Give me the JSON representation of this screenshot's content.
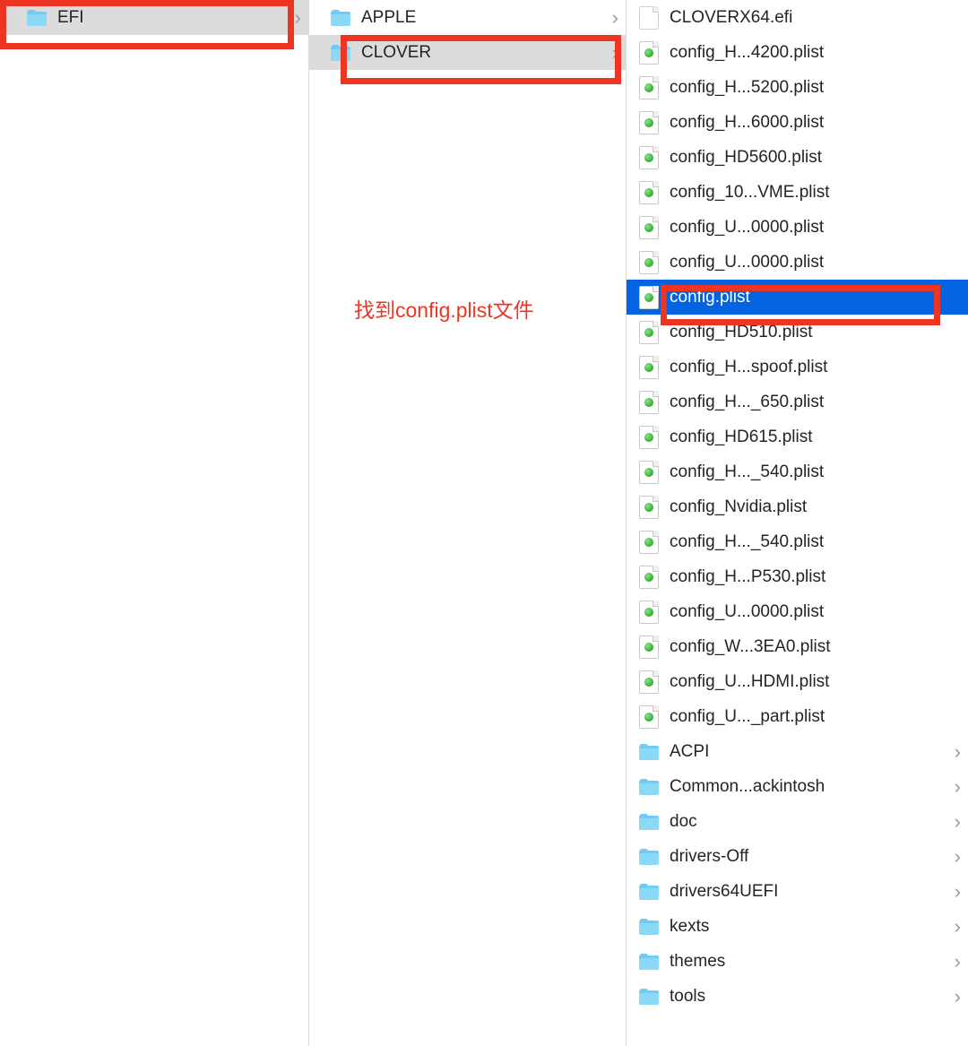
{
  "annotation_text": "找到config.plist文件",
  "column1": {
    "items": [
      {
        "type": "folder",
        "name": "EFI",
        "selected": true
      }
    ]
  },
  "column2": {
    "items": [
      {
        "type": "folder",
        "name": "APPLE",
        "selected": false
      },
      {
        "type": "folder",
        "name": "CLOVER",
        "selected": true
      }
    ]
  },
  "column3": {
    "items": [
      {
        "type": "efi",
        "name": "CLOVERX64.efi",
        "selected": false
      },
      {
        "type": "plist",
        "name": "config_H...4200.plist",
        "selected": false
      },
      {
        "type": "plist",
        "name": "config_H...5200.plist",
        "selected": false
      },
      {
        "type": "plist",
        "name": "config_H...6000.plist",
        "selected": false
      },
      {
        "type": "plist",
        "name": "config_HD5600.plist",
        "selected": false
      },
      {
        "type": "plist",
        "name": "config_10...VME.plist",
        "selected": false
      },
      {
        "type": "plist",
        "name": "config_U...0000.plist",
        "selected": false
      },
      {
        "type": "plist",
        "name": "config_U...0000.plist",
        "selected": false
      },
      {
        "type": "plist",
        "name": "config.plist",
        "selected": true
      },
      {
        "type": "plist",
        "name": "config_HD510.plist",
        "selected": false
      },
      {
        "type": "plist",
        "name": "config_H...spoof.plist",
        "selected": false
      },
      {
        "type": "plist",
        "name": "config_H..._650.plist",
        "selected": false
      },
      {
        "type": "plist",
        "name": "config_HD615.plist",
        "selected": false
      },
      {
        "type": "plist",
        "name": "config_H..._540.plist",
        "selected": false
      },
      {
        "type": "plist",
        "name": "config_Nvidia.plist",
        "selected": false
      },
      {
        "type": "plist",
        "name": "config_H..._540.plist",
        "selected": false
      },
      {
        "type": "plist",
        "name": "config_H...P530.plist",
        "selected": false
      },
      {
        "type": "plist",
        "name": "config_U...0000.plist",
        "selected": false
      },
      {
        "type": "plist",
        "name": "config_W...3EA0.plist",
        "selected": false
      },
      {
        "type": "plist",
        "name": "config_U...HDMI.plist",
        "selected": false
      },
      {
        "type": "plist",
        "name": "config_U..._part.plist",
        "selected": false
      },
      {
        "type": "folder",
        "name": "ACPI",
        "selected": false
      },
      {
        "type": "folder",
        "name": "Common...ackintosh",
        "selected": false
      },
      {
        "type": "folder",
        "name": "doc",
        "selected": false
      },
      {
        "type": "folder",
        "name": "drivers-Off",
        "selected": false
      },
      {
        "type": "folder",
        "name": "drivers64UEFI",
        "selected": false
      },
      {
        "type": "folder",
        "name": "kexts",
        "selected": false
      },
      {
        "type": "folder",
        "name": "themes",
        "selected": false
      },
      {
        "type": "folder",
        "name": "tools",
        "selected": false
      }
    ]
  }
}
